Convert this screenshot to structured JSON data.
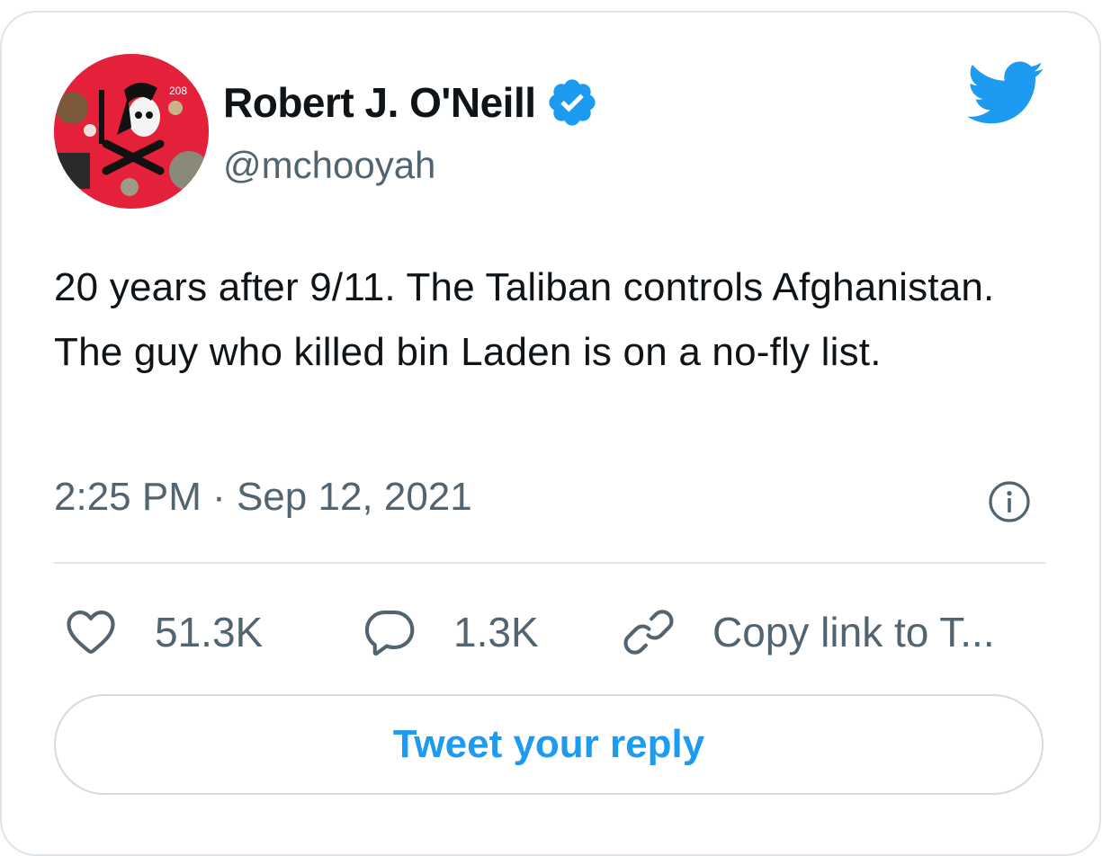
{
  "tweet": {
    "author": {
      "display_name": "Robert J. O'Neill",
      "handle": "@mchooyah",
      "verified": true
    },
    "text": "20 years after 9/11. The Taliban controls Afghanistan. The guy who killed bin Laden is on a no-fly list.",
    "timestamp": "2:25 PM · Sep 12, 2021"
  },
  "actions": {
    "like_count": "51.3K",
    "reply_count": "1.3K",
    "copy_link_label": "Copy link to T..."
  },
  "reply_button": {
    "label": "Tweet your reply"
  },
  "icons": {
    "verified": "verified-badge-icon",
    "logo": "twitter-bird-icon",
    "info": "info-icon",
    "like": "heart-icon",
    "reply": "speech-bubble-icon",
    "copy": "link-icon"
  },
  "colors": {
    "accent": "#1d9bf0",
    "text": "#0f1419",
    "secondary_text": "#536471",
    "border": "#dfe4e8",
    "avatar_bg": "#e4203b"
  }
}
